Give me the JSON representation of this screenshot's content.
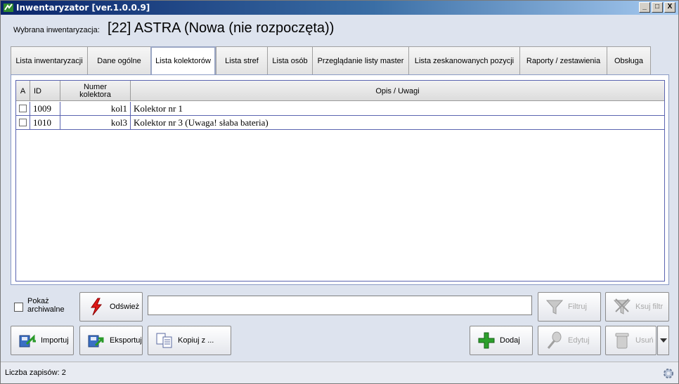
{
  "window": {
    "title": "Inwentaryzator [ver.1.0.0.9]",
    "controls": [
      "_",
      "□",
      "X"
    ]
  },
  "header": {
    "label": "Wybrana inwentaryzacja:",
    "value": "[22] ASTRA (Nowa (nie rozpoczęta))"
  },
  "tabs": [
    {
      "label": "Lista inwentaryzacji"
    },
    {
      "label": "Dane ogólne"
    },
    {
      "label": "Lista kolektorów",
      "active": true
    },
    {
      "label": "Lista stref"
    },
    {
      "label": "Lista osób"
    },
    {
      "label": "Przeglądanie listy master"
    },
    {
      "label": "Lista zeskanowanych pozycji"
    },
    {
      "label": "Raporty / zestawienia"
    },
    {
      "label": "Obsługa"
    }
  ],
  "grid": {
    "columns": [
      "A",
      "ID",
      "Numer kolektora",
      "Opis / Uwagi"
    ],
    "rows": [
      {
        "a": false,
        "id": "1009",
        "numer": "kol1",
        "opis": "Kolektor nr 1"
      },
      {
        "a": false,
        "id": "1010",
        "numer": "kol3",
        "opis": "Kolektor nr 3 (Uwaga! słaba bateria)"
      }
    ]
  },
  "controls": {
    "show_archived": "Pokaż archiwalne",
    "refresh": "Odśwież",
    "filter_value": "",
    "filter": "Filtruj",
    "clear_filter": "Ksuj filtr",
    "import": "Importuj",
    "export": "Eksportuj",
    "copy_from": "Kopiuj z ...",
    "add": "Dodaj",
    "edit": "Edytuj",
    "delete": "Usuń"
  },
  "status": {
    "text": "Liczba zapisów: 2"
  }
}
